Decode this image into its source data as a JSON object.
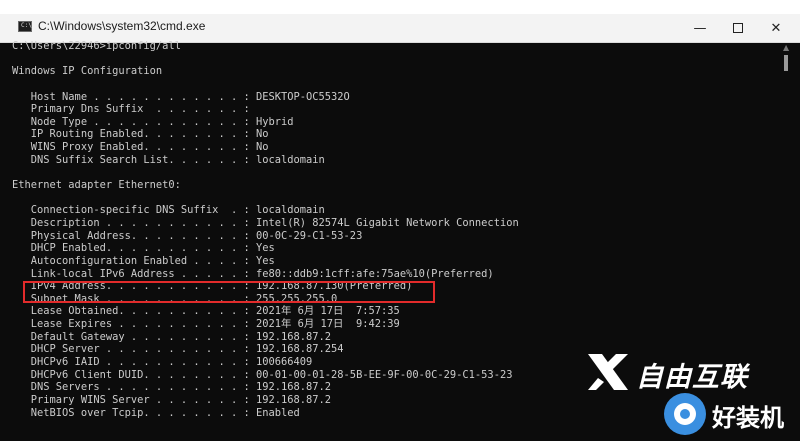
{
  "window": {
    "title": "C:\\Windows\\system32\\cmd.exe",
    "app_icon_text": "C:\\",
    "minimize_glyph": "—",
    "close_glyph": "✕"
  },
  "console": {
    "lines": [
      "C:\\Users\\22946>ipconfig/all",
      "",
      "Windows IP Configuration",
      "",
      "   Host Name . . . . . . . . . . . . : DESKTOP-OC5532O",
      "   Primary Dns Suffix  . . . . . . . :",
      "   Node Type . . . . . . . . . . . . : Hybrid",
      "   IP Routing Enabled. . . . . . . . : No",
      "   WINS Proxy Enabled. . . . . . . . : No",
      "   DNS Suffix Search List. . . . . . : localdomain",
      "",
      "Ethernet adapter Ethernet0:",
      "",
      "   Connection-specific DNS Suffix  . : localdomain",
      "   Description . . . . . . . . . . . : Intel(R) 82574L Gigabit Network Connection",
      "   Physical Address. . . . . . . . . : 00-0C-29-C1-53-23",
      "   DHCP Enabled. . . . . . . . . . . : Yes",
      "   Autoconfiguration Enabled . . . . : Yes",
      "   Link-local IPv6 Address . . . . . : fe80::ddb9:1cff:afe:75ae%10(Preferred)",
      "   IPv4 Address. . . . . . . . . . . : 192.168.87.130(Preferred)",
      "   Subnet Mask . . . . . . . . . . . : 255.255.255.0",
      "   Lease Obtained. . . . . . . . . . : 2021年 6月 17日  7:57:35",
      "   Lease Expires . . . . . . . . . . : 2021年 6月 17日  9:42:39",
      "   Default Gateway . . . . . . . . . : 192.168.87.2",
      "   DHCP Server . . . . . . . . . . . : 192.168.87.254",
      "   DHCPv6 IAID . . . . . . . . . . . : 100666409",
      "   DHCPv6 Client DUID. . . . . . . . : 00-01-00-01-28-5B-EE-9F-00-0C-29-C1-53-23",
      "   DNS Servers . . . . . . . . . . . : 192.168.87.2",
      "   Primary WINS Server . . . . . . . : 192.168.87.2",
      "   NetBIOS over Tcpip. . . . . . . . : Enabled"
    ]
  },
  "watermarks": {
    "brand1": "自由互联",
    "brand2": "好装机"
  },
  "colors": {
    "console_bg": "#0c0c0c",
    "console_text": "#cccccc",
    "highlight": "#e22b2b",
    "brand2_blue": "#3a8fe0"
  }
}
